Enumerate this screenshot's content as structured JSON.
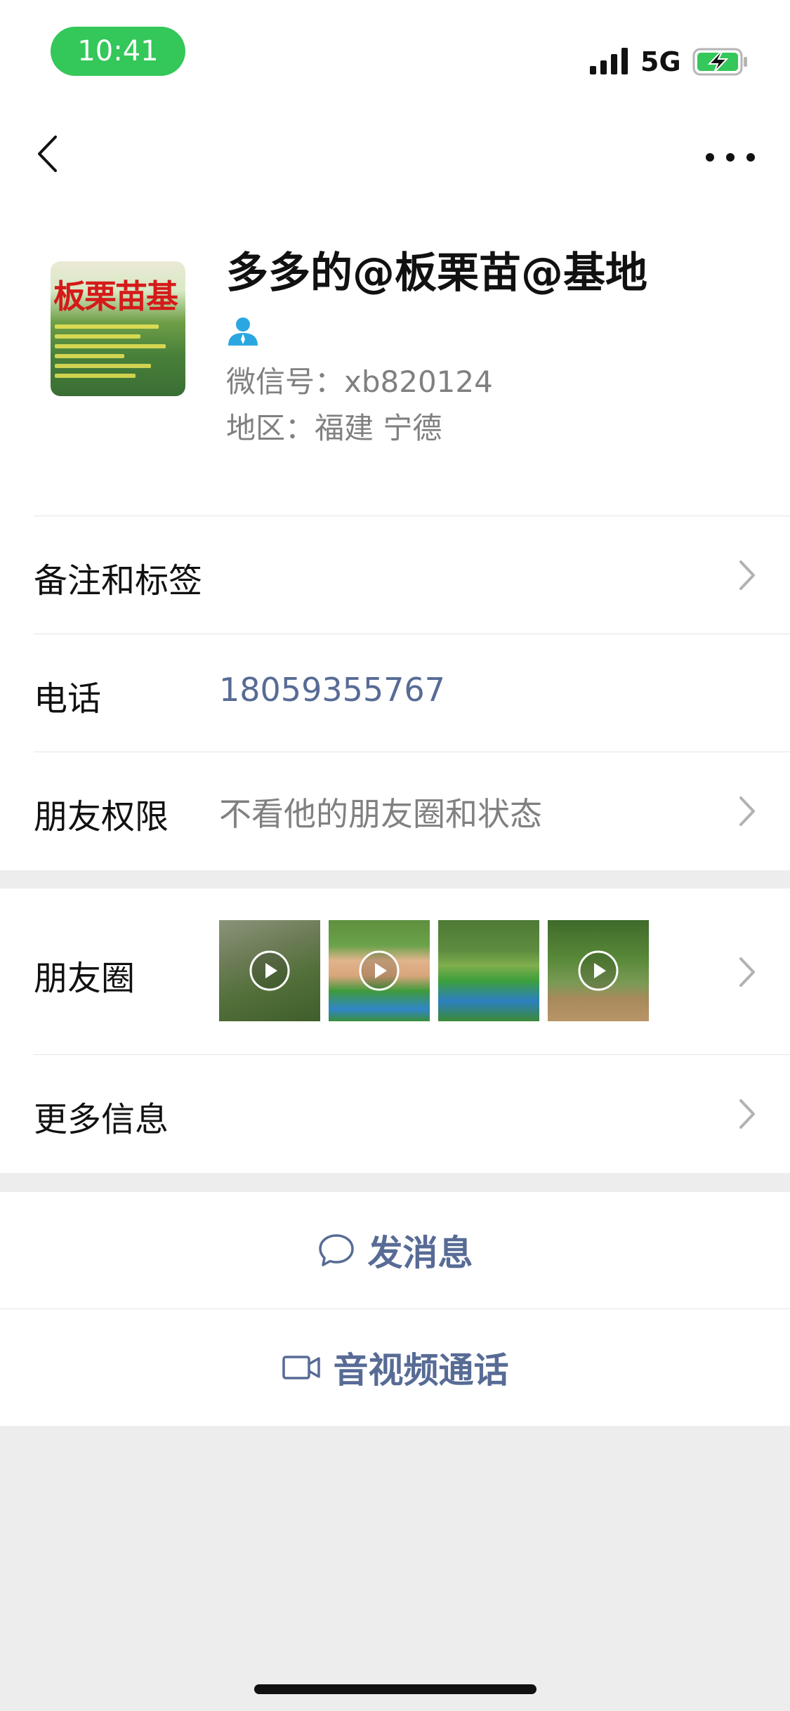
{
  "status_bar": {
    "time": "10:41",
    "network": "5G",
    "accent_color": "#34c759"
  },
  "nav": {
    "back_icon": "chevron-left-icon",
    "more_icon": "more-dots-icon"
  },
  "profile": {
    "avatar_text": "板栗苗基",
    "name": "多多的@板栗苗@基地",
    "contact_icon": "person-icon",
    "wechat_id": "微信号：xb820124",
    "region": "地区：福建 宁德"
  },
  "rows": {
    "remarks": {
      "label": "备注和标签"
    },
    "phone": {
      "label": "电话",
      "value": "18059355767"
    },
    "permissions": {
      "label": "朋友权限",
      "value": "不看他的朋友圈和状态"
    },
    "moments": {
      "label": "朋友圈",
      "thumbnail_count": 4
    },
    "more_info": {
      "label": "更多信息"
    }
  },
  "actions": {
    "message": {
      "label": "发消息",
      "icon": "chat-bubble-icon"
    },
    "call": {
      "label": "音视频通话",
      "icon": "video-camera-icon"
    }
  },
  "colors": {
    "link": "#576b95",
    "secondary_text": "#808080",
    "background": "#ededed"
  }
}
